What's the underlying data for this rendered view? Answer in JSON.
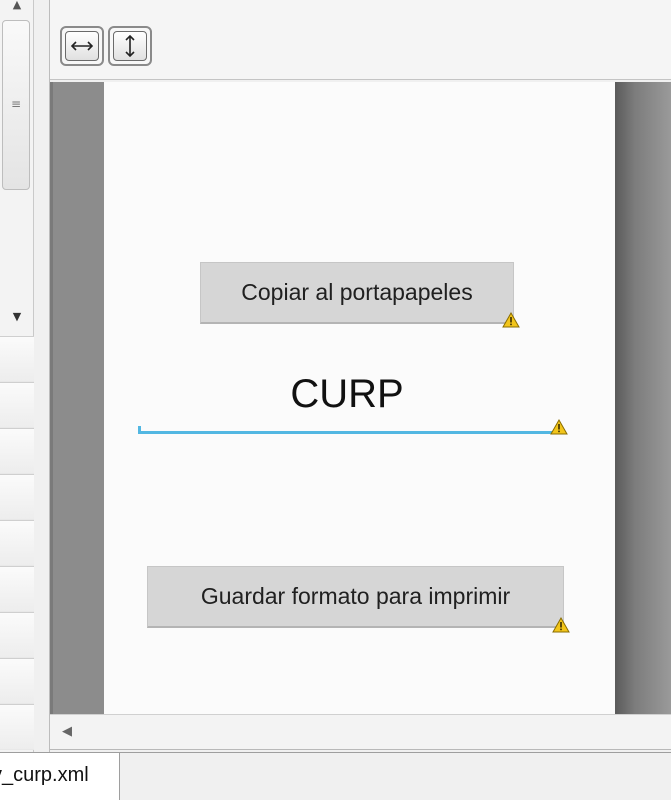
{
  "preview": {
    "copy_button_label": "Copiar al portapapeles",
    "curp_text": "CURP",
    "save_button_label": "Guardar formato para imprimir",
    "accent_color": "#52b7e2",
    "warning_color": "#f2c51a"
  },
  "toolbar": {
    "buttons": [
      {
        "icon": "fit-width-icon"
      },
      {
        "icon": "fit-height-icon"
      }
    ]
  },
  "tabs": {
    "file_tab_label": "v_curp.xml"
  }
}
